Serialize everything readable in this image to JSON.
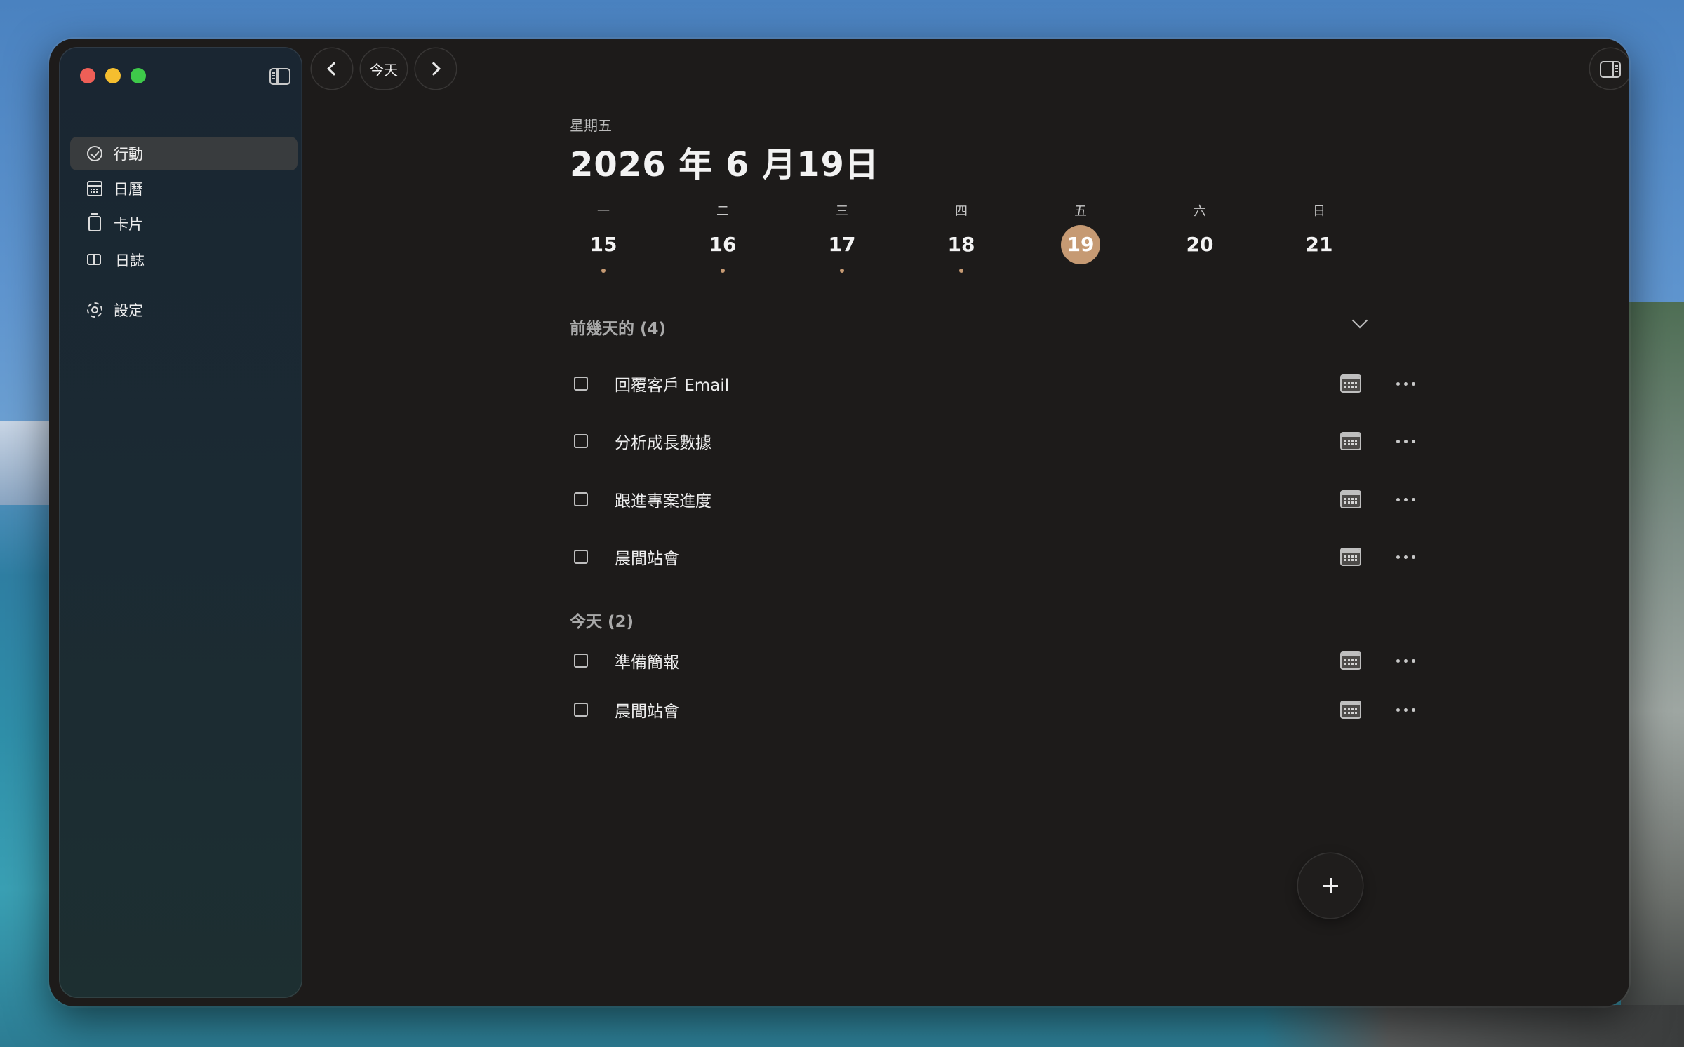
{
  "sidebar": {
    "items": [
      {
        "label": "行動",
        "icon": "check-circle-icon",
        "active": true
      },
      {
        "label": "日曆",
        "icon": "calendar-icon",
        "active": false
      },
      {
        "label": "卡片",
        "icon": "card-icon",
        "active": false
      },
      {
        "label": "日誌",
        "icon": "book-icon",
        "active": false
      },
      {
        "label": "設定",
        "icon": "gear-icon",
        "active": false
      }
    ]
  },
  "toolbar": {
    "today_label": "今天"
  },
  "header": {
    "weekday": "星期五",
    "date": "2026 年 6 月19日"
  },
  "week": {
    "days": [
      {
        "label": "一",
        "num": "15",
        "has_dot": true,
        "selected": false
      },
      {
        "label": "二",
        "num": "16",
        "has_dot": true,
        "selected": false
      },
      {
        "label": "三",
        "num": "17",
        "has_dot": true,
        "selected": false
      },
      {
        "label": "四",
        "num": "18",
        "has_dot": true,
        "selected": false
      },
      {
        "label": "五",
        "num": "19",
        "has_dot": false,
        "selected": true
      },
      {
        "label": "六",
        "num": "20",
        "has_dot": false,
        "selected": false
      },
      {
        "label": "日",
        "num": "21",
        "has_dot": false,
        "selected": false
      }
    ]
  },
  "sections": {
    "previous": {
      "title": "前幾天的 (4)",
      "tasks": [
        "回覆客戶 Email",
        "分析成長數據",
        "跟進專案進度",
        "晨間站會"
      ]
    },
    "today": {
      "title": "今天 (2)",
      "tasks": [
        "準備簡報",
        "晨間站會"
      ]
    }
  },
  "colors": {
    "accent": "#c69a73",
    "window_bg": "#1d1b1a",
    "sidebar_bg": "#1b2a33"
  }
}
